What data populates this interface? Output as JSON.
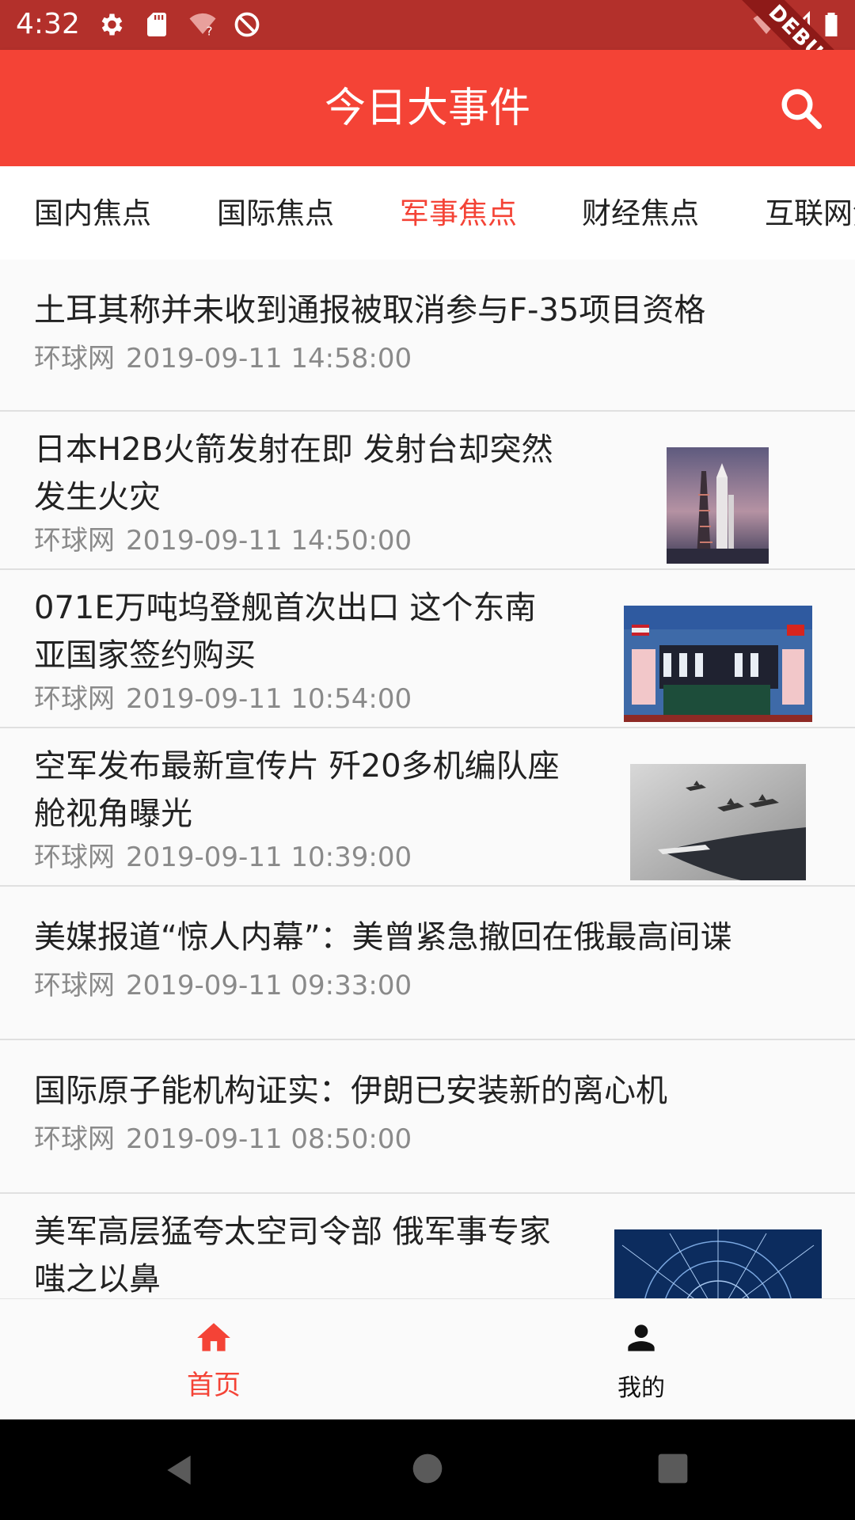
{
  "status_bar": {
    "time": "4:32",
    "icons": [
      "gear-icon",
      "sd-card-icon",
      "wifi-question-icon",
      "no-sync-icon"
    ],
    "right_icons": [
      "wifi-off-icon",
      "signal-icon",
      "battery-icon"
    ],
    "debug_label": "DEBUG"
  },
  "app_bar": {
    "title": "今日大事件",
    "search_icon": "search-icon"
  },
  "tabs": [
    {
      "label": "国内焦点",
      "active": false
    },
    {
      "label": "国际焦点",
      "active": false
    },
    {
      "label": "军事焦点",
      "active": true
    },
    {
      "label": "财经焦点",
      "active": false
    },
    {
      "label": "互联网焦点",
      "active": false
    }
  ],
  "colors": {
    "accent": "#f44336",
    "status_bar": "#b3302b",
    "meta_text": "#8a8a8a"
  },
  "news": [
    {
      "title_lines": [
        "土耳其称并未收到通报被取消参与F-35项目资格"
      ],
      "source": "环球网",
      "time": "2019-09-11 14:58:00",
      "has_image": false
    },
    {
      "title_lines": [
        "日本H2B火箭发射在即 发射台却突然",
        "发生火灾"
      ],
      "source": "环球网",
      "time": "2019-09-11 14:50:00",
      "has_image": true,
      "image": "rocket-launch-pad"
    },
    {
      "title_lines": [
        "071E万吨坞登舰首次出口 这个东南",
        "亚国家签约购买"
      ],
      "source": "环球网",
      "time": "2019-09-11 10:54:00",
      "has_image": true,
      "image": "signing-ceremony"
    },
    {
      "title_lines": [
        "空军发布最新宣传片 歼20多机编队座",
        "舱视角曝光"
      ],
      "source": "环球网",
      "time": "2019-09-11 10:39:00",
      "has_image": true,
      "image": "fighter-jets"
    },
    {
      "title_lines": [
        "美媒报道“惊人内幕”：美曾紧急撤回在俄最高间谍"
      ],
      "source": "环球网",
      "time": "2019-09-11 09:33:00",
      "has_image": false
    },
    {
      "title_lines": [
        "国际原子能机构证实：伊朗已安装新的离心机"
      ],
      "source": "环球网",
      "time": "2019-09-11 08:50:00",
      "has_image": false
    },
    {
      "title_lines": [
        "美军高层猛夸太空司令部 俄军事专家",
        "嗤之以鼻"
      ],
      "source": "",
      "time": "",
      "has_image": true,
      "image": "space-grid"
    }
  ],
  "bottom_nav": [
    {
      "label": "首页",
      "icon": "home-icon",
      "active": true
    },
    {
      "label": "我的",
      "icon": "person-icon",
      "active": false
    }
  ],
  "system_nav": [
    "back-icon",
    "home-circle-icon",
    "recents-icon"
  ]
}
